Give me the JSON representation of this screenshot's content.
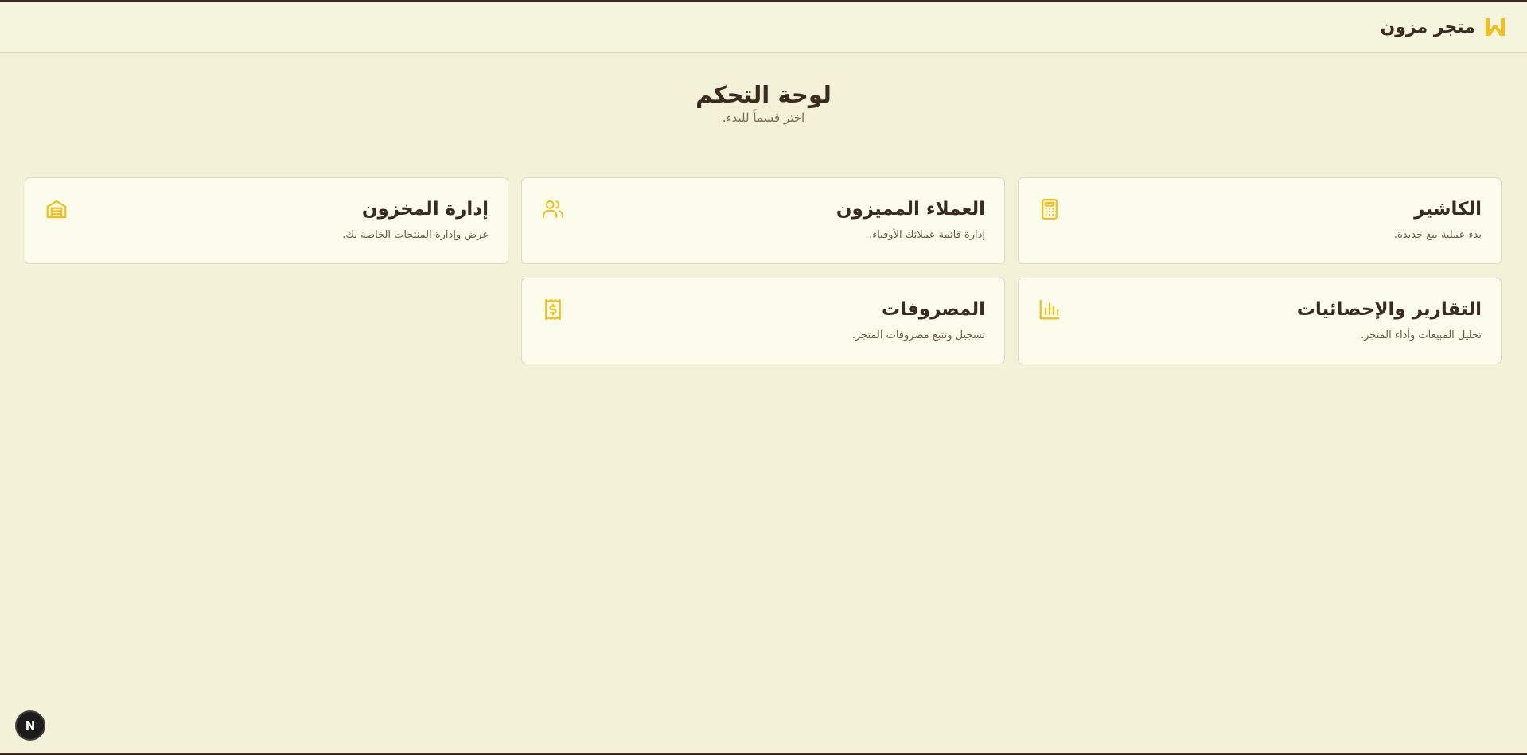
{
  "brand": {
    "name": "متجر مزون",
    "logo_icon": "m-logo-icon",
    "accent": "#f2c01c"
  },
  "page": {
    "title": "لوحة التحكم",
    "subtitle": "اختر قسماً للبدء."
  },
  "cards": [
    {
      "title": "الكاشير",
      "desc": "بدء عملية بيع جديدة.",
      "icon": "calculator-icon"
    },
    {
      "title": "العملاء المميزون",
      "desc": "إدارة قائمة عملائك الأوفياء.",
      "icon": "users-icon"
    },
    {
      "title": "إدارة المخزون",
      "desc": "عرض وإدارة المنتجات الخاصة بك.",
      "icon": "warehouse-icon"
    },
    {
      "title": "التقارير والإحصائيات",
      "desc": "تحليل المبيعات وأداء المتجر.",
      "icon": "bar-chart-icon"
    },
    {
      "title": "المصروفات",
      "desc": "تسجيل وتتبع مصروفات المتجر.",
      "icon": "receipt-icon"
    }
  ],
  "dev_badge": {
    "letter": "N"
  }
}
